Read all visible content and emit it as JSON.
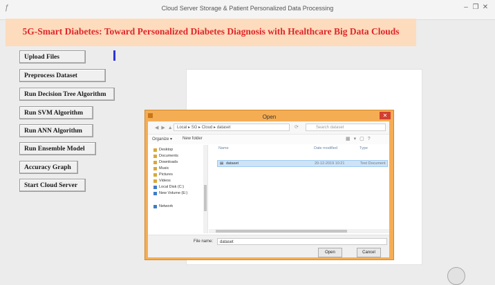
{
  "window": {
    "title": "Cloud Server Storage & Patient Personalized Data Processing",
    "app_icon": "feather-icon",
    "buttons": [
      "–",
      "❐",
      "✕"
    ]
  },
  "banner": {
    "text": "5G-Smart Diabetes: Toward Personalized Diabetes Diagnosis with Healthcare Big Data Clouds"
  },
  "buttons": [
    {
      "label": "Upload Files"
    },
    {
      "label": "Preprocess Dataset"
    },
    {
      "label": "Run Decision Tree Algorithm"
    },
    {
      "label": "Run SVM Algorithm"
    },
    {
      "label": "Run ANN Algorithm"
    },
    {
      "label": "Run Ensemble Model"
    },
    {
      "label": "Accuracy Graph"
    },
    {
      "label": "Start Cloud Server"
    }
  ],
  "dialog": {
    "title": "Open",
    "path": "Local ▸ SG ▸ Cloud ▸ dataset",
    "search_placeholder": "Search dataset",
    "organize": "Organize ▾",
    "new_folder": "New folder",
    "nav_items": [
      {
        "label": "Desktop",
        "icon": "folder-icon"
      },
      {
        "label": "Documents",
        "icon": "folder-icon"
      },
      {
        "label": "Downloads",
        "icon": "folder-icon"
      },
      {
        "label": "Music",
        "icon": "folder-icon"
      },
      {
        "label": "Pictures",
        "icon": "folder-icon"
      },
      {
        "label": "Videos",
        "icon": "folder-icon"
      },
      {
        "label": "Local Disk (C:)",
        "icon": "drive-icon"
      },
      {
        "label": "New Volume (E:)",
        "icon": "drive-icon"
      },
      {
        "label": "Network",
        "icon": "network-icon"
      }
    ],
    "columns": {
      "name": "Name",
      "date": "Date modified",
      "type": "Type"
    },
    "files": [
      {
        "name": "dataset",
        "date": "20-12-2019 10:21",
        "type": "Text Document"
      }
    ],
    "file_name_label": "File name:",
    "file_name_value": "dataset",
    "open_label": "Open",
    "cancel_label": "Cancel"
  }
}
